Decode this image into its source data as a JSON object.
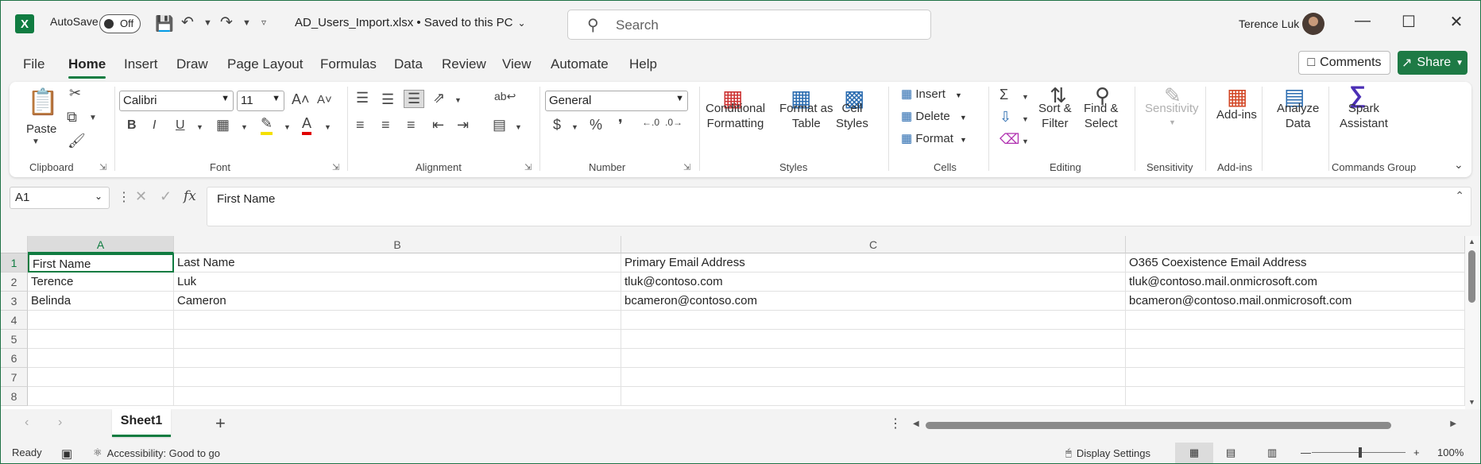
{
  "app": {
    "logo_letter": "X",
    "autosave_label": "AutoSave",
    "autosave_state": "Off",
    "file_title": "AD_Users_Import.xlsx • Saved to this PC",
    "search_placeholder": "Search",
    "user_name": "Terence Luk"
  },
  "menu": {
    "tabs": [
      "File",
      "Home",
      "Insert",
      "Draw",
      "Page Layout",
      "Formulas",
      "Data",
      "Review",
      "View",
      "Automate",
      "Help"
    ],
    "active": "Home",
    "comments": "Comments",
    "share": "Share"
  },
  "ribbon": {
    "clipboard": {
      "paste": "Paste",
      "label": "Clipboard"
    },
    "font": {
      "name": "Calibri",
      "size": "11",
      "label": "Font"
    },
    "alignment": {
      "label": "Alignment"
    },
    "number": {
      "format": "General",
      "label": "Number"
    },
    "styles": {
      "cond1": "Conditional",
      "cond2": "Formatting",
      "fmt1": "Format as",
      "fmt2": "Table",
      "cell1": "Cell",
      "cell2": "Styles",
      "label": "Styles"
    },
    "cells": {
      "insert": "Insert",
      "delete": "Delete",
      "format": "Format",
      "label": "Cells"
    },
    "editing": {
      "sort1": "Sort &",
      "sort2": "Filter",
      "find1": "Find &",
      "find2": "Select",
      "label": "Editing"
    },
    "sensitivity": {
      "btn": "Sensitivity",
      "label": "Sensitivity"
    },
    "addins": {
      "btn": "Add-ins",
      "label": "Add-ins"
    },
    "analyze": {
      "l1": "Analyze",
      "l2": "Data"
    },
    "spark": {
      "l1": "Spark",
      "l2": "Assistant",
      "label": "Commands Group"
    }
  },
  "formula_bar": {
    "name_box": "A1",
    "fx": "fx",
    "content": "First Name"
  },
  "sheet": {
    "columns": [
      "A",
      "B",
      "C",
      ""
    ],
    "row_numbers": [
      "1",
      "2",
      "3",
      "4",
      "5",
      "6",
      "7",
      "8"
    ],
    "rows": [
      [
        "First Name",
        "Last Name",
        "Primary Email Address",
        "O365 Coexistence Email Address"
      ],
      [
        "Terence",
        "Luk",
        "tluk@contoso.com",
        "tluk@contoso.mail.onmicrosoft.com"
      ],
      [
        "Belinda",
        "Cameron",
        "bcameron@contoso.com",
        "bcameron@contoso.mail.onmicrosoft.com"
      ],
      [
        "",
        "",
        "",
        ""
      ],
      [
        "",
        "",
        "",
        ""
      ],
      [
        "",
        "",
        "",
        ""
      ],
      [
        "",
        "",
        "",
        ""
      ],
      [
        "",
        "",
        "",
        ""
      ]
    ],
    "tab_name": "Sheet1"
  },
  "status": {
    "ready": "Ready",
    "accessibility": "Accessibility: Good to go",
    "display_settings": "Display Settings",
    "zoom": "100%"
  },
  "colors": {
    "accent": "#107c41",
    "share_bg": "#1e7a45"
  }
}
